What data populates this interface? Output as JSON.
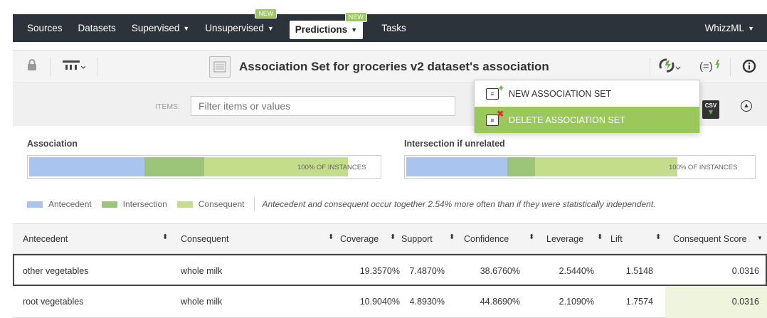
{
  "nav": {
    "items": [
      {
        "label": "Sources",
        "caret": false,
        "badge": ""
      },
      {
        "label": "Datasets",
        "caret": false,
        "badge": ""
      },
      {
        "label": "Supervised",
        "caret": true,
        "badge": ""
      },
      {
        "label": "Unsupervised",
        "caret": true,
        "badge": "NEW"
      },
      {
        "label": "Predictions",
        "caret": true,
        "badge": "NEW",
        "active": true
      },
      {
        "label": "Tasks",
        "caret": false,
        "badge": ""
      }
    ],
    "right_label": "WhizzML"
  },
  "titlebar": {
    "title": "Association Set for groceries v2 dataset's association",
    "icons": [
      "lock-icon",
      "model-tree-icon",
      "actions-icon",
      "formula-icon",
      "info-icon"
    ]
  },
  "filter": {
    "items_label": "ITEMS:",
    "placeholder": "Filter items or values",
    "csv_label": "CSV"
  },
  "dropdown": {
    "items": [
      {
        "label": "NEW ASSOCIATION SET",
        "icon": "add-set-icon",
        "highlighted": false
      },
      {
        "label": "DELETE ASSOCIATION SET",
        "icon": "delete-set-icon",
        "highlighted": true
      }
    ]
  },
  "association": {
    "label": "Association",
    "pct_label": "100% OF INSTANCES",
    "antecedent": 0.33,
    "intersection": 0.17,
    "consequent": 0.41
  },
  "intersection": {
    "label": "Intersection if unrelated",
    "pct_label": "100% OF INSTANCES",
    "antecedent": 0.29,
    "intersection": 0.08,
    "consequent": 0.41
  },
  "legend": {
    "antecedent": "Antecedent",
    "intersection": "Intersection",
    "consequent": "Consequent",
    "text": "Antecedent and consequent occur together 2.54% more often than if they were statistically independent."
  },
  "colors": {
    "antecedent": "#a9c5ef",
    "intersection": "#9cc57a",
    "consequent": "#c4dd8a",
    "accent": "#9bc85a"
  },
  "table": {
    "headers": [
      "Antecedent",
      "Consequent",
      "Coverage",
      "Support",
      "Confidence",
      "Leverage",
      "Lift",
      "Consequent Score"
    ],
    "rows": [
      [
        "other vegetables",
        "whole milk",
        "19.3570%",
        "7.4870%",
        "38.6760%",
        "2.5440%",
        "1.5148",
        "0.0316"
      ],
      [
        "root vegetables",
        "whole milk",
        "10.9040%",
        "4.8930%",
        "44.8690%",
        "2.1090%",
        "1.7574",
        "0.0316"
      ]
    ]
  }
}
